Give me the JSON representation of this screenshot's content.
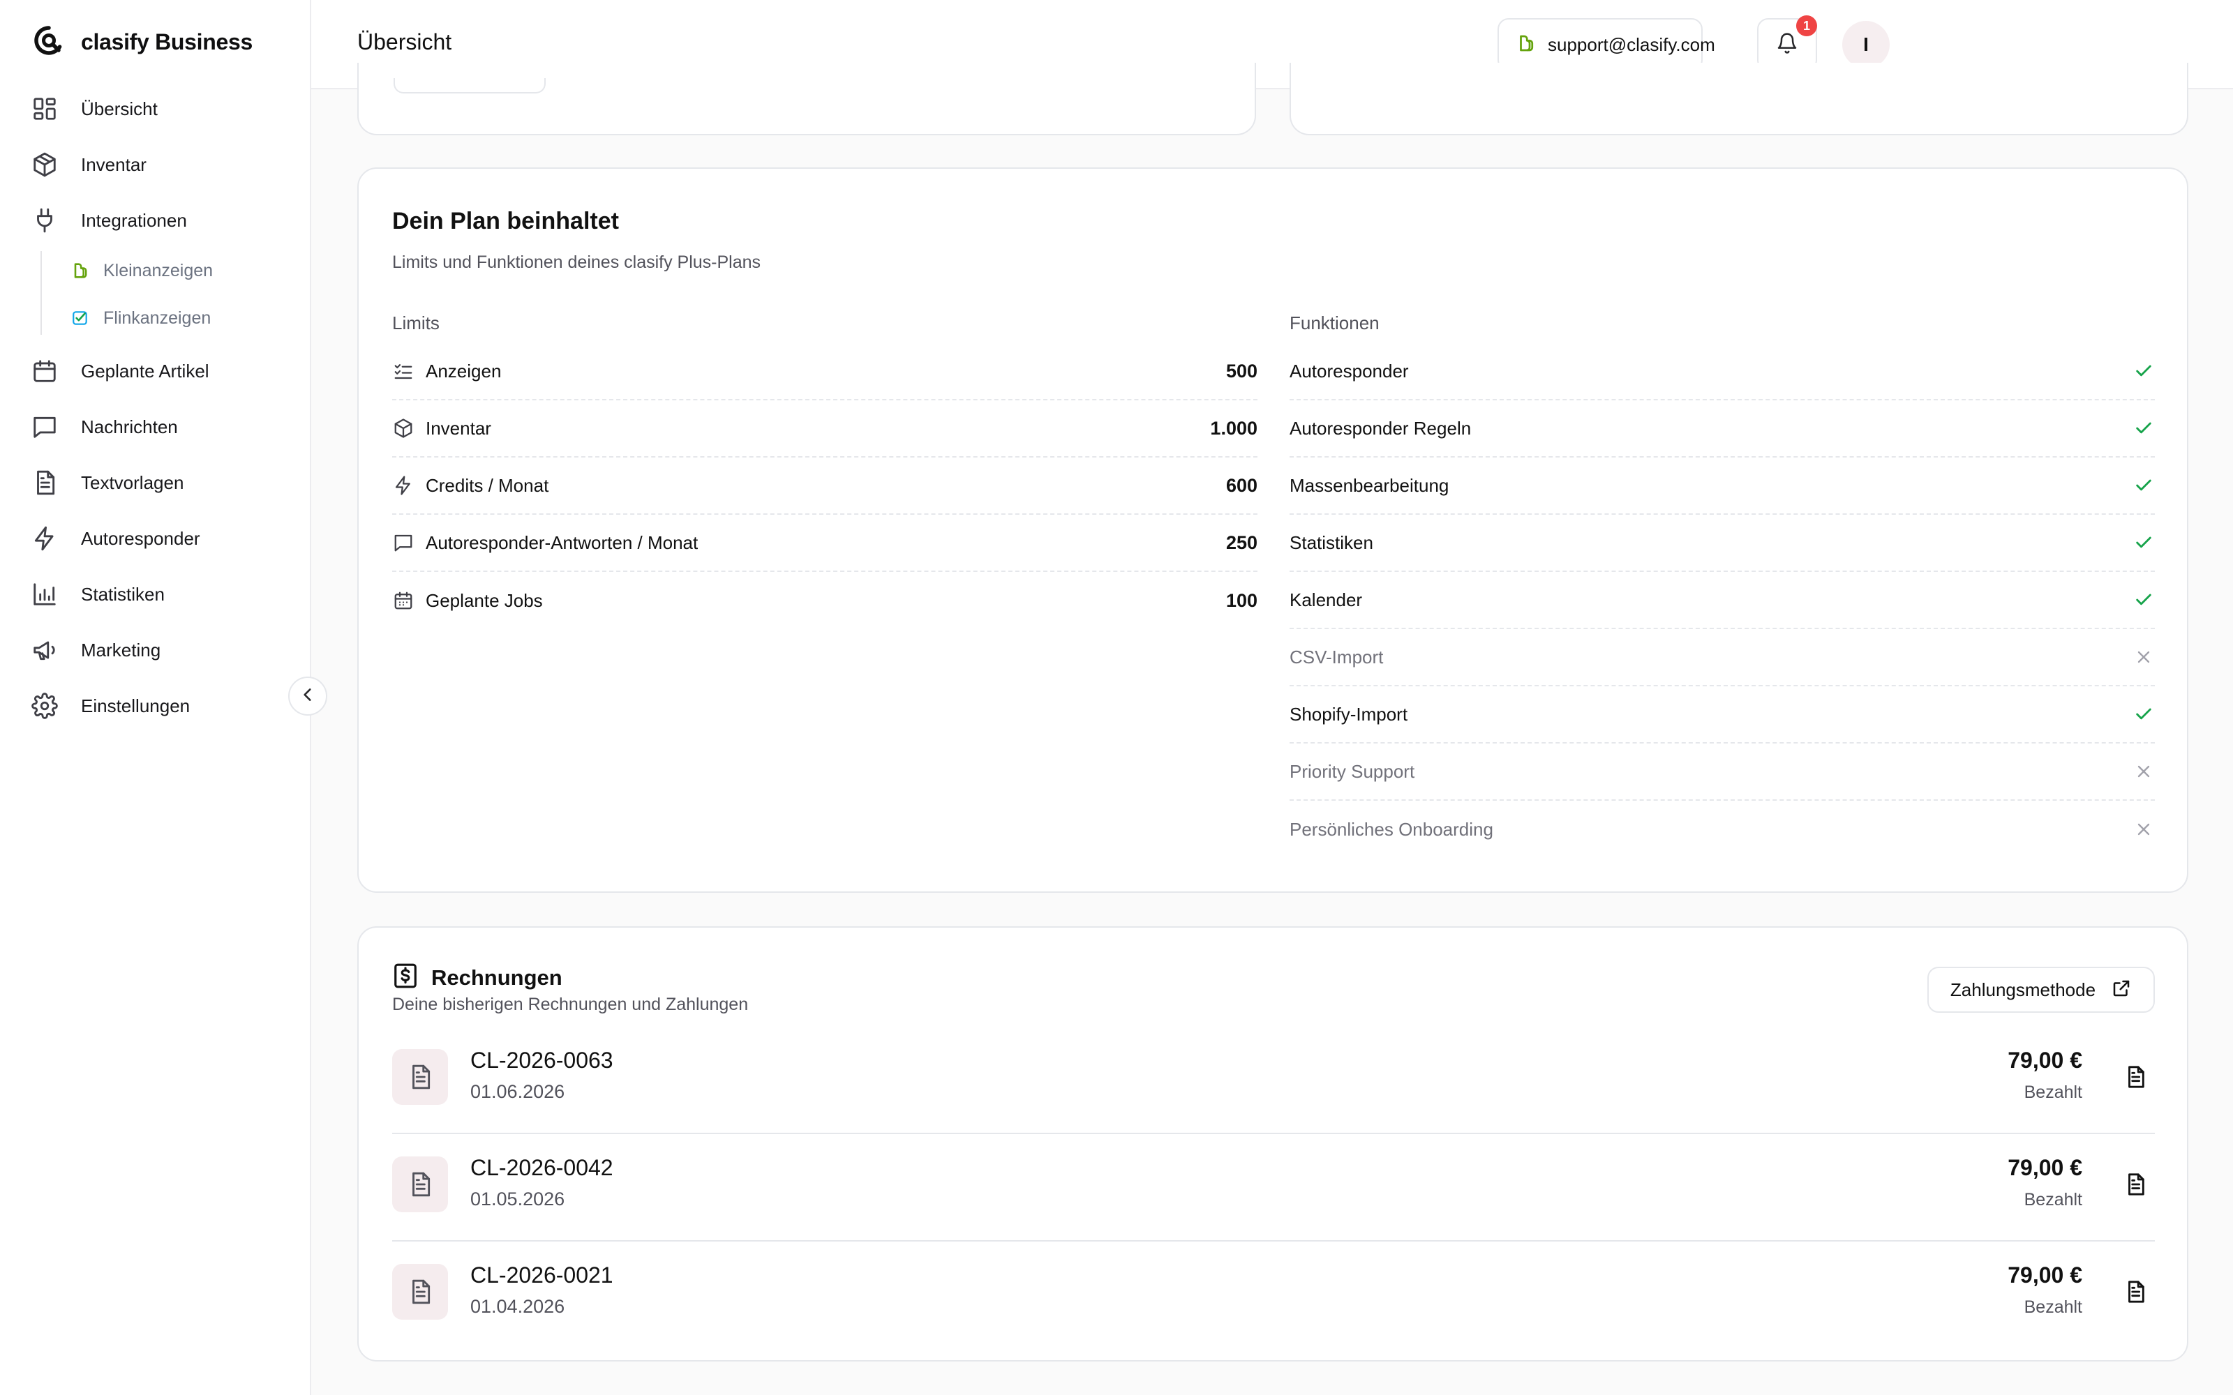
{
  "app": {
    "name": "clasify Business"
  },
  "sidebar": {
    "items": [
      {
        "label": "Übersicht",
        "icon": "dashboard-icon"
      },
      {
        "label": "Inventar",
        "icon": "package-icon"
      },
      {
        "label": "Integrationen",
        "icon": "plug-icon"
      },
      {
        "label": "Geplante Artikel",
        "icon": "calendar-icon"
      },
      {
        "label": "Nachrichten",
        "icon": "message-icon"
      },
      {
        "label": "Textvorlagen",
        "icon": "document-icon"
      },
      {
        "label": "Autoresponder",
        "icon": "lightning-icon"
      },
      {
        "label": "Statistiken",
        "icon": "bar-chart-icon"
      },
      {
        "label": "Marketing",
        "icon": "megaphone-icon"
      },
      {
        "label": "Einstellungen",
        "icon": "gear-icon"
      }
    ],
    "sub_items": [
      {
        "label": "Kleinanzeigen",
        "icon": "kleinanzeigen-logo-icon"
      },
      {
        "label": "Flinkanzeigen",
        "icon": "flinkanzeigen-logo-icon"
      }
    ]
  },
  "header": {
    "title": "Übersicht",
    "support_label": "support@clasify.com",
    "notification_count": "1",
    "avatar_initial": "I"
  },
  "plan": {
    "title": "Dein Plan beinhaltet",
    "subtitle": "Limits und Funktionen deines clasify Plus-Plans",
    "limits_heading": "Limits",
    "features_heading": "Funktionen",
    "limits": [
      {
        "name": "Anzeigen",
        "value": "500",
        "icon": "list-check-icon"
      },
      {
        "name": "Inventar",
        "value": "1.000",
        "icon": "package-icon"
      },
      {
        "name": "Credits / Monat",
        "value": "600",
        "icon": "lightning-icon"
      },
      {
        "name": "Autoresponder-Antworten / Monat",
        "value": "250",
        "icon": "message-icon"
      },
      {
        "name": "Geplante Jobs",
        "value": "100",
        "icon": "calendar-icon"
      }
    ],
    "features": [
      {
        "name": "Autoresponder",
        "included": true
      },
      {
        "name": "Autoresponder Regeln",
        "included": true
      },
      {
        "name": "Massenbearbeitung",
        "included": true
      },
      {
        "name": "Statistiken",
        "included": true
      },
      {
        "name": "Kalender",
        "included": true
      },
      {
        "name": "CSV-Import",
        "included": false
      },
      {
        "name": "Shopify-Import",
        "included": true
      },
      {
        "name": "Priority Support",
        "included": false
      },
      {
        "name": "Persönliches Onboarding",
        "included": false
      }
    ]
  },
  "invoices": {
    "title": "Rechnungen",
    "subtitle": "Deine bisherigen Rechnungen und Zahlungen",
    "payment_button": "Zahlungsmethode",
    "rows": [
      {
        "number": "CL-2026-0063",
        "date": "01.06.2026",
        "amount": "79,00 €",
        "status": "Bezahlt"
      },
      {
        "number": "CL-2026-0042",
        "date": "01.05.2026",
        "amount": "79,00 €",
        "status": "Bezahlt"
      },
      {
        "number": "CL-2026-0021",
        "date": "01.04.2026",
        "amount": "79,00 €",
        "status": "Bezahlt"
      }
    ]
  },
  "colors": {
    "accent_green": "#16a34a",
    "badge_red": "#ef4444",
    "tile_bg": "#f5ecee"
  }
}
